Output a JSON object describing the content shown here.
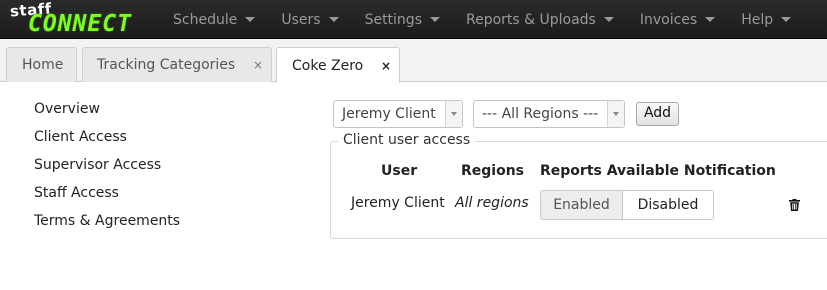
{
  "brand": {
    "top": "staff",
    "bottom": "CONNECT"
  },
  "nav": {
    "items": [
      {
        "label": "Schedule"
      },
      {
        "label": "Users"
      },
      {
        "label": "Settings"
      },
      {
        "label": "Reports & Uploads"
      },
      {
        "label": "Invoices"
      },
      {
        "label": "Help"
      }
    ]
  },
  "tabs": [
    {
      "label": "Home"
    },
    {
      "label": "Tracking Categories",
      "close": "×"
    },
    {
      "label": "Coke Zero",
      "close": "×"
    }
  ],
  "sidebar": {
    "items": [
      {
        "label": "Overview"
      },
      {
        "label": "Client Access"
      },
      {
        "label": "Supervisor Access"
      },
      {
        "label": "Staff Access"
      },
      {
        "label": "Terms & Agreements"
      }
    ]
  },
  "controls": {
    "client_select": "Jeremy Client",
    "region_select": "--- All Regions ---",
    "add_label": "Add"
  },
  "access": {
    "legend": "Client user access",
    "headers": {
      "user": "User",
      "regions": "Regions",
      "reports": "Reports Available Notification"
    },
    "rows": [
      {
        "user": "Jeremy Client",
        "regions": "All regions",
        "enabled_label": "Enabled",
        "disabled_label": "Disabled",
        "selected": "Disabled"
      }
    ]
  },
  "colors": {
    "navbar": "#222222",
    "logo_green": "#7dfc1f",
    "nav_text": "#9a9a9a"
  }
}
